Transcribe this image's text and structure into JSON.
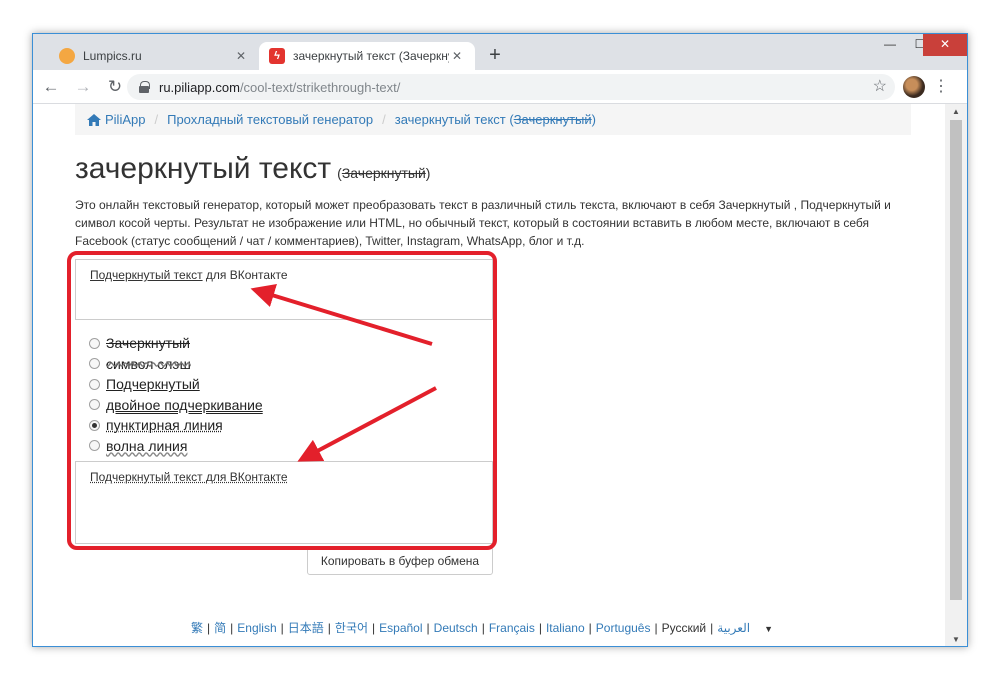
{
  "browser": {
    "tabs": [
      {
        "title": "Lumpics.ru",
        "active": false
      },
      {
        "title": "зачеркнутый текст (Зачеркнутый",
        "active": true
      }
    ],
    "new_tab": "+",
    "url_domain": "ru.piliapp.com",
    "url_path": "/cool-text/strikethrough-text/"
  },
  "breadcrumb": {
    "home": "PiliApp",
    "section": "Прохладный текстовый генератор",
    "current_main": "зачеркнутый текст (",
    "current_strike": "Зачеркнутый",
    "current_close": ")"
  },
  "page": {
    "title": "зачеркнутый текст",
    "title_paren_open": "(",
    "title_strike": "Зачеркнутый",
    "title_paren_close": ")",
    "description": "Это онлайн текстовый генератор, который может преобразовать текст в различный стиль текста, включают в себя Зачеркнутый , Подчеркнутый и символ косой черты. Результат не изображение или HTML, но обычный текст, который в состоянии вставить в любом месте, включают в себя Facebook (статус сообщений / чат / комментариев), Twitter, Instagram, WhatsApp, блог и т.д."
  },
  "input": {
    "value_underlined": "Подчеркнутый текст",
    "value_rest": " для ВКонтакте"
  },
  "styles": [
    {
      "label": "Зачеркнутый",
      "selected": false
    },
    {
      "label": "символ слэш",
      "selected": false
    },
    {
      "label": "Подчеркнутый",
      "selected": false
    },
    {
      "label": "двойное подчеркивание",
      "selected": false
    },
    {
      "label": "пунктирная линия",
      "selected": true
    },
    {
      "label": "волна линия",
      "selected": false
    }
  ],
  "output": {
    "value": "Подчеркнутый текст для ВКонтакте"
  },
  "copy_button": "Копировать в буфер обмена",
  "languages": [
    "繁",
    "简",
    "English",
    "日本語",
    "한국어",
    "Español",
    "Deutsch",
    "Français",
    "Italiano",
    "Português",
    "Русский",
    "العربية"
  ],
  "colors": {
    "highlight": "#e3202b",
    "link": "#337ab7"
  }
}
